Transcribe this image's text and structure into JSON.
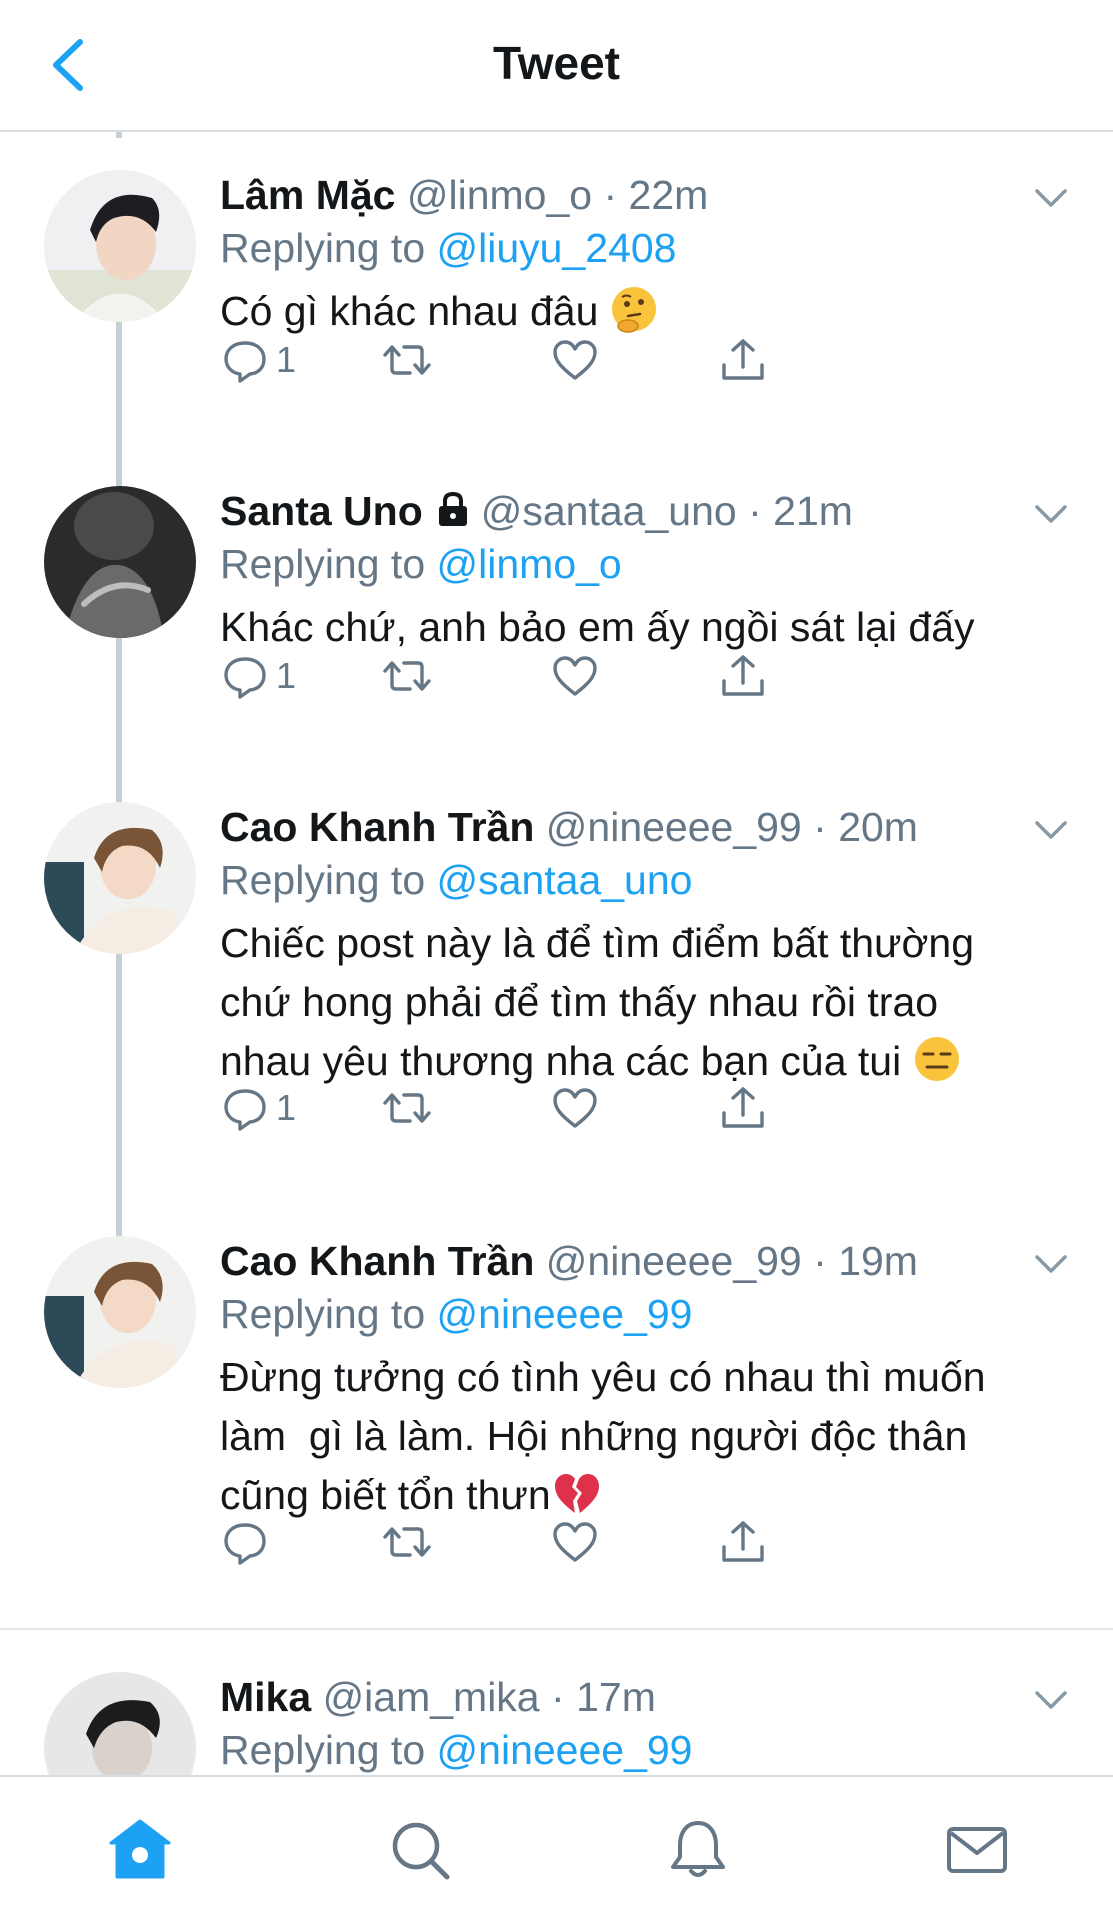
{
  "header": {
    "title": "Tweet"
  },
  "icons": {
    "back": "chevron-left-icon",
    "menu": "chevron-down-icon",
    "reply": "speech-bubble-icon",
    "retweet": "retweet-icon",
    "like": "heart-icon",
    "share": "share-icon",
    "lock": "lock-icon"
  },
  "colors": {
    "accent": "#1da1f2",
    "muted": "#657786",
    "text": "#14171a"
  },
  "tweets": [
    {
      "name": "Lâm Mặc",
      "handle": "@linmo_o",
      "dot": "·",
      "time": "22m",
      "reply_prefix": "Replying to",
      "reply_to": "@liuyu_2408",
      "text_lines": [
        "Có gì khác nhau đâu"
      ],
      "emoji": "thinking-face",
      "reply_count": "1"
    },
    {
      "name": "Santa Uno",
      "protected": true,
      "handle": "@santaa_uno",
      "dot": "·",
      "time": "21m",
      "reply_prefix": "Replying to",
      "reply_to": "@linmo_o",
      "text_lines": [
        "Khác chứ, anh bảo em ấy ngồi sát lại đấy"
      ],
      "reply_count": "1"
    },
    {
      "name": "Cao Khanh Trần",
      "handle": "@nineeee_99",
      "dot": "·",
      "time": "20m",
      "reply_prefix": "Replying to",
      "reply_to": "@santaa_uno",
      "text_lines": [
        "Chiếc post này là để tìm điểm bất thường",
        "chứ hong phải để tìm thấy nhau rồi trao",
        "nhau yêu thương nha các bạn của tui"
      ],
      "emoji": "expressionless-face",
      "reply_count": "1"
    },
    {
      "name": "Cao Khanh Trần",
      "handle": "@nineeee_99",
      "dot": "·",
      "time": "19m",
      "reply_prefix": "Replying to",
      "reply_to": "@nineeee_99",
      "text_lines": [
        "Đừng tưởng có tình yêu có nhau thì muốn",
        "làm  gì là làm. Hội những người độc thân",
        "cũng biết tổn thưn"
      ],
      "emoji": "broken-heart",
      "reply_count": ""
    },
    {
      "name": "Mika",
      "handle": "@iam_mika",
      "dot": "·",
      "time": "17m",
      "reply_prefix": "Replying to",
      "reply_to": "@nineeee_99"
    }
  ],
  "tabbar": {
    "items": [
      "home-icon",
      "search-icon",
      "bell-icon",
      "mail-icon"
    ],
    "active": "home-icon"
  }
}
